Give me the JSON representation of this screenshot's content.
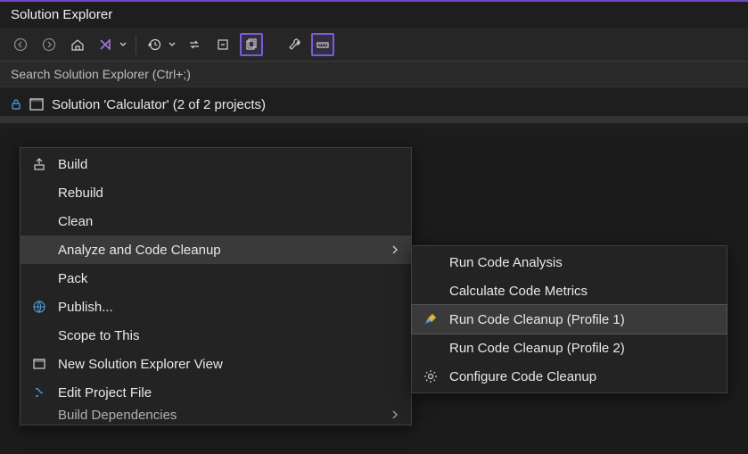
{
  "panel": {
    "title": "Solution Explorer"
  },
  "search": {
    "placeholder": "Search Solution Explorer (Ctrl+;)"
  },
  "tree": {
    "solution_label": "Solution 'Calculator' (2 of 2 projects)"
  },
  "context_menu": {
    "items": {
      "build": "Build",
      "rebuild": "Rebuild",
      "clean": "Clean",
      "analyze": "Analyze and Code Cleanup",
      "pack": "Pack",
      "publish": "Publish...",
      "scope": "Scope to This",
      "new_view": "New Solution Explorer View",
      "edit_project": "Edit Project File",
      "build_deps": "Build Dependencies"
    }
  },
  "submenu": {
    "items": {
      "run_analysis": "Run Code Analysis",
      "calc_metrics": "Calculate Code Metrics",
      "cleanup_p1": "Run Code Cleanup (Profile 1)",
      "cleanup_p2": "Run Code Cleanup (Profile 2)",
      "configure": "Configure Code Cleanup"
    }
  }
}
